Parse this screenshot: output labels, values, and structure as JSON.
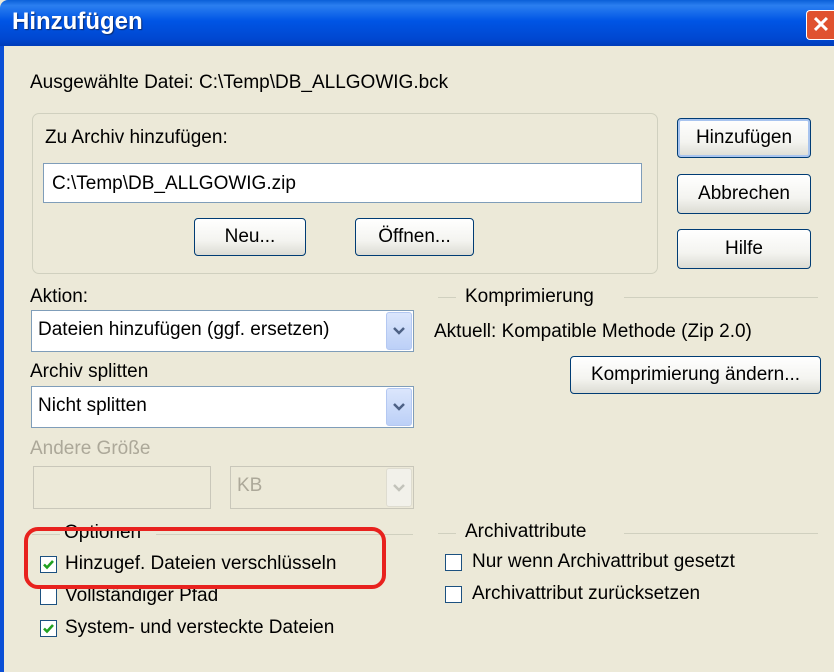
{
  "window": {
    "title": "Hinzufügen",
    "close_glyph": "✕"
  },
  "selected_file": "Ausgewählte Datei: C:\\Temp\\DB_ALLGOWIG.bck",
  "archive": {
    "label": "Zu Archiv hinzufügen:",
    "path": "C:\\Temp\\DB_ALLGOWIG.zip",
    "new_button": "Neu...",
    "open_button": "Öffnen..."
  },
  "buttons": {
    "add": "Hinzufügen",
    "cancel": "Abbrechen",
    "help": "Hilfe"
  },
  "action": {
    "label": "Aktion:",
    "value": "Dateien hinzufügen (ggf. ersetzen)"
  },
  "split": {
    "label": "Archiv splitten",
    "value": "Nicht splitten"
  },
  "size": {
    "label": "Andere Größe",
    "value": "",
    "unit": "KB"
  },
  "compression": {
    "heading": "Komprimierung",
    "current": "Aktuell: Kompatible Methode (Zip 2.0)",
    "change_button": "Komprimierung ändern..."
  },
  "options": {
    "heading": "Optionen",
    "items": [
      {
        "label": "Hinzugef. Dateien verschlüsseln",
        "checked": true
      },
      {
        "label": "Vollständiger Pfad",
        "checked": false
      },
      {
        "label": "System- und versteckte Dateien",
        "checked": true
      }
    ]
  },
  "attributes": {
    "heading": "Archivattribute",
    "items": [
      {
        "label": "Nur wenn Archivattribut gesetzt",
        "checked": false
      },
      {
        "label": "Archivattribut zurücksetzen",
        "checked": false
      }
    ]
  },
  "colors": {
    "titlebar": "#0055e5",
    "highlight": "#e8221e",
    "dialog_bg": "#ece9d8",
    "check": "#21a121"
  },
  "icons": {
    "close": "close-icon",
    "dropdown": "chevron-down-icon",
    "check": "check-icon"
  }
}
